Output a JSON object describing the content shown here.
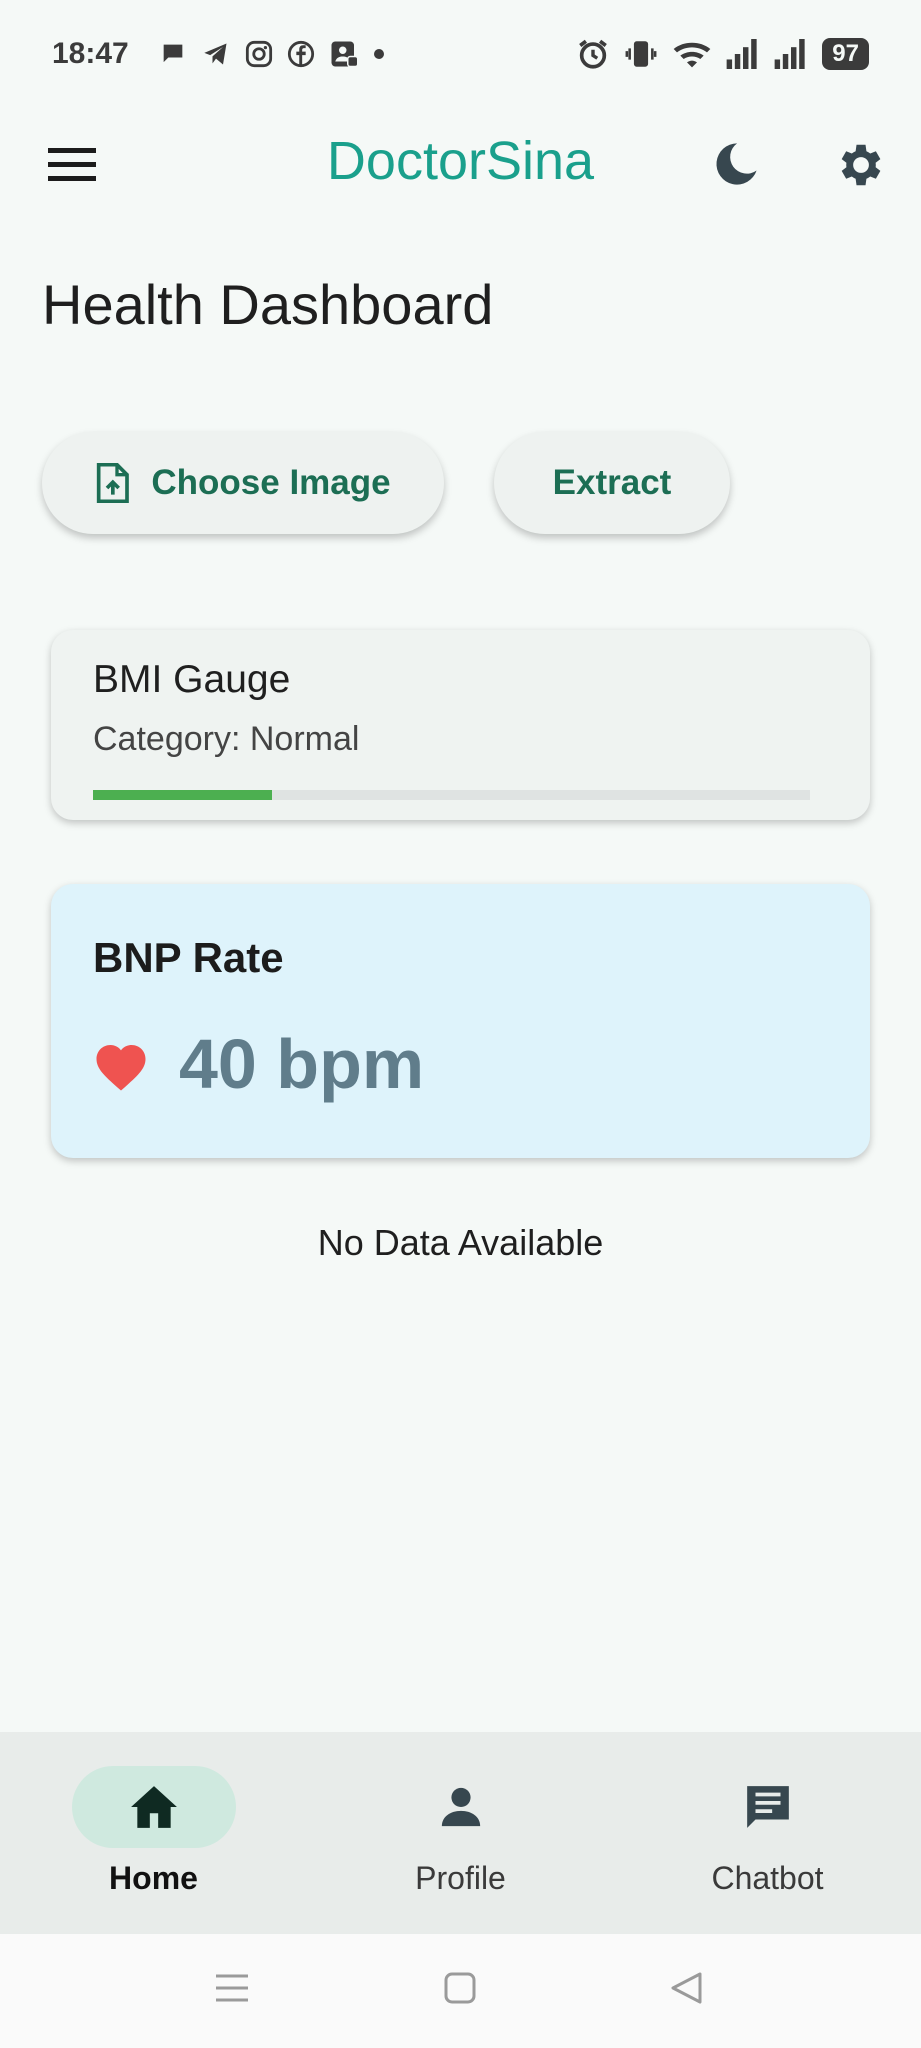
{
  "status_bar": {
    "time": "18:47",
    "battery": "97",
    "notification_icons": [
      "chat-bubble-icon",
      "telegram-icon",
      "instagram-icon",
      "facebook-icon",
      "profile-card-icon",
      "dot-icon"
    ],
    "system_icons": [
      "alarm-icon",
      "vibrate-icon",
      "wifi-icon",
      "signal-icon",
      "signal-icon"
    ]
  },
  "appbar": {
    "title": "DoctorSina",
    "title_color": "#1aa08c"
  },
  "page": {
    "title": "Health Dashboard"
  },
  "actions": {
    "choose_image_label": "Choose Image",
    "extract_label": "Extract"
  },
  "bmi": {
    "title": "BMI Gauge",
    "category": "Category: Normal",
    "progress_fraction": 0.25,
    "progress_color": "#4caf50"
  },
  "bnp": {
    "title": "BNP Rate",
    "value": "40 bpm",
    "heart_color": "#ef5350"
  },
  "main": {
    "no_data": "No Data Available"
  },
  "bottom_nav": {
    "items": [
      {
        "label": "Home",
        "icon": "home-icon",
        "active": true
      },
      {
        "label": "Profile",
        "icon": "person-icon",
        "active": false
      },
      {
        "label": "Chatbot",
        "icon": "chat-icon",
        "active": false
      }
    ]
  }
}
